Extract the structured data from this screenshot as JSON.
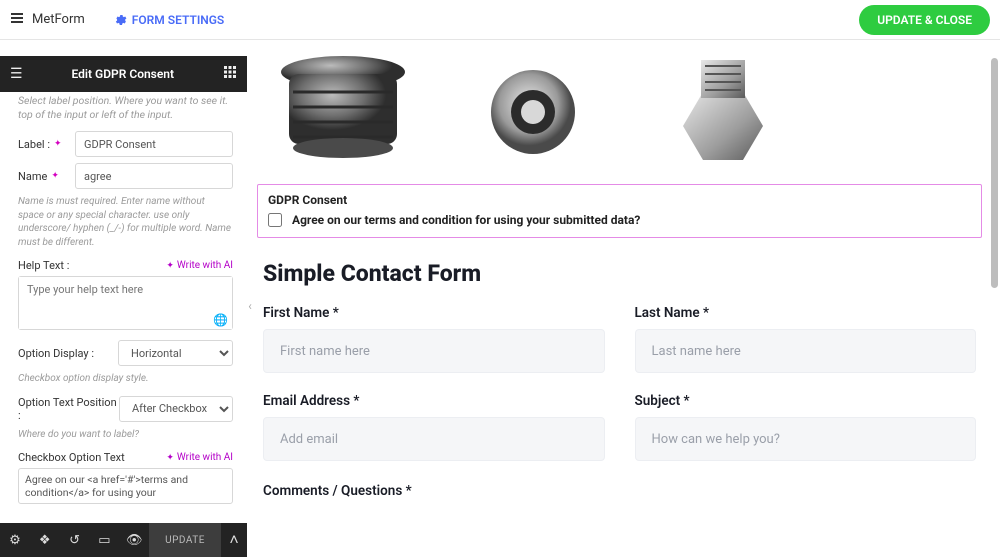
{
  "topbar": {
    "brand": "MetForm",
    "form_settings": "FORM SETTINGS",
    "update_close": "UPDATE & CLOSE"
  },
  "sidebar": {
    "header_title": "Edit GDPR Consent",
    "help_top": "Select label position. Where you want to see it. top of the input or left of the input.",
    "label_lbl": "Label :",
    "label_val": "GDPR Consent",
    "name_lbl": "Name",
    "name_val": "agree",
    "name_help": "Name is must required. Enter name without space or any special character. use only underscore/ hyphen (_/-) for multiple word. Name must be different.",
    "helptext_lbl": "Help Text :",
    "write_with_ai": "Write with AI",
    "helptext_ph": "Type your help text here",
    "option_display_lbl": "Option Display :",
    "option_display_val": "Horizontal",
    "option_display_help": "Checkbox option display style.",
    "option_textpos_lbl": "Option Text Position :",
    "option_textpos_val": "After Checkbox",
    "option_textpos_help": "Where do you want to label?",
    "checkbox_option_lbl": "Checkbox Option Text",
    "checkbox_option_val": "Agree on our <a href='#'>terms and condition</a> for using your"
  },
  "bottombar": {
    "update": "UPDATE"
  },
  "canvas": {
    "gdpr_title": "GDPR Consent",
    "gdpr_text": "Agree on our terms and condition for using your submitted data?",
    "form_title": "Simple Contact Form",
    "first_name_lbl": "First Name *",
    "first_name_ph": "First name here",
    "last_name_lbl": "Last Name *",
    "last_name_ph": "Last name here",
    "email_lbl": "Email Address *",
    "email_ph": "Add email",
    "subject_lbl": "Subject *",
    "subject_ph": "How can we help you?",
    "comments_lbl": "Comments / Questions *"
  }
}
